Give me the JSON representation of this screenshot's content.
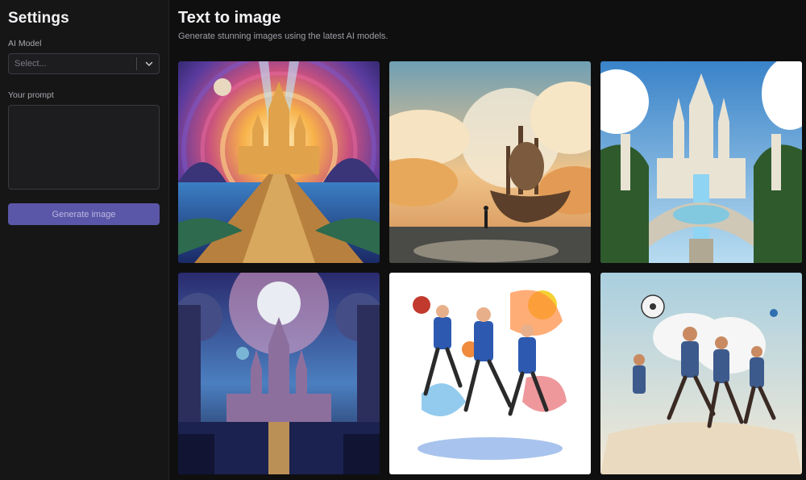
{
  "sidebar": {
    "title": "Settings",
    "model_label": "AI Model",
    "model_placeholder": "Select...",
    "prompt_label": "Your prompt",
    "prompt_value": "",
    "generate_label": "Generate image",
    "accent": "#5b57a8"
  },
  "main": {
    "title": "Text to image",
    "subtitle": "Generate stunning images using the latest AI models."
  },
  "gallery": {
    "images": [
      {
        "name": "psychedelic-castle-bridge-image"
      },
      {
        "name": "steampunk-airship-moon-image"
      },
      {
        "name": "crystal-palace-waterfall-image"
      },
      {
        "name": "moonlit-castle-lake-image"
      },
      {
        "name": "runners-splash-art-image"
      },
      {
        "name": "runners-soccer-ball-image"
      }
    ]
  },
  "icons": {
    "select_chevron": "chevron-down-icon"
  }
}
